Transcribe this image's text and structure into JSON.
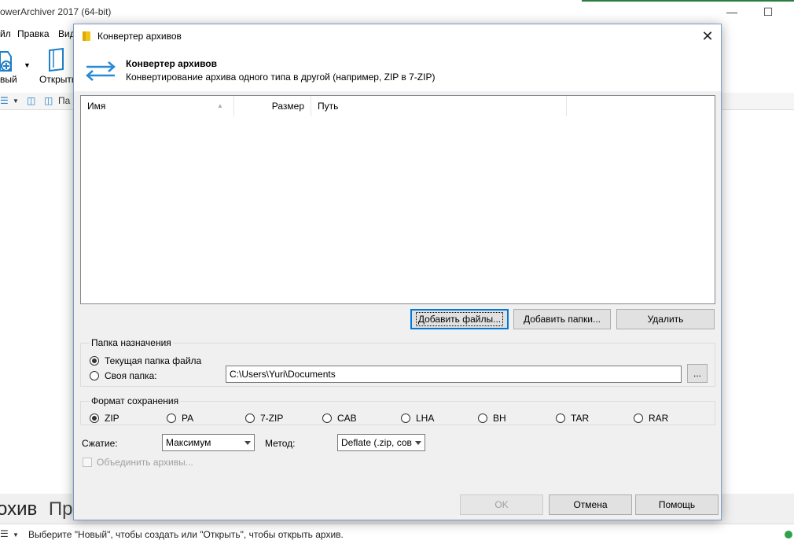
{
  "main_window": {
    "title": "owerArchiver 2017 (64-bit)",
    "menu": [
      "йл",
      "Правка",
      "Вид"
    ],
    "toolbar": {
      "new_label": "вый",
      "open_label": "Открыть"
    },
    "view_bar": {
      "folders_label": "Па"
    },
    "bottom_text": {
      "part1": "охив",
      "part2": "Про"
    },
    "status": "Выберите \"Новый\", чтобы создать или \"Открыть\", чтобы открыть архив."
  },
  "dialog": {
    "title": "Конвертер архивов",
    "header_title": "Конвертер архивов",
    "header_subtitle": "Конвертирование архива одного типа в другой (например, ZIP в 7-ZIP)",
    "columns": {
      "name": "Имя",
      "size": "Размер",
      "path": "Путь"
    },
    "buttons": {
      "add_files": "Добавить файлы...",
      "add_folders": "Добавить папки...",
      "delete": "Удалить",
      "browse": "...",
      "ok": "OK",
      "cancel": "Отмена",
      "help": "Помощь"
    },
    "destination": {
      "group_label": "Папка назначения",
      "current_folder": "Текущая папка файла",
      "own_folder": "Своя папка:",
      "path": "C:\\Users\\Yuri\\Documents"
    },
    "format": {
      "group_label": "Формат сохранения",
      "options": [
        "ZIP",
        "PA",
        "7-ZIP",
        "CAB",
        "LHA",
        "BH",
        "TAR",
        "RAR"
      ],
      "selected": "ZIP"
    },
    "compression": {
      "label": "Сжатие:",
      "value": "Максимум"
    },
    "method": {
      "label": "Метод:",
      "value": "Deflate (.zip, сов"
    },
    "merge_label": "Объединить архивы..."
  },
  "colors": {
    "accent": "#0078d7",
    "arrow_icon": "#2a8ad4",
    "status_ok": "#2fa14a"
  }
}
